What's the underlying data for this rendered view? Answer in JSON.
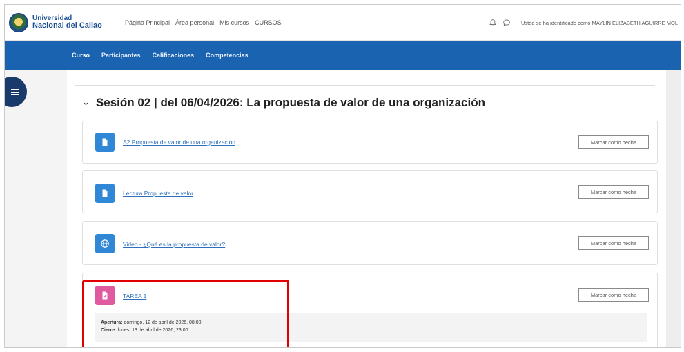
{
  "brand": {
    "line1": "Universidad",
    "line2": "Nacional del Callao"
  },
  "topnav": [
    "Página Principal",
    "Área personal",
    "Mis cursos",
    "CURSOS"
  ],
  "user_text": "Usted se ha identificado como MAYLIN ELIZABETH AGUIRRE MOL",
  "subnav": {
    "active": "Curso",
    "items": [
      "Curso",
      "Participantes",
      "Calificaciones",
      "Competencias"
    ]
  },
  "section": {
    "chevron": "⌄",
    "title": "Sesión 02 | del 06/04/2026: La propuesta de valor de una organización"
  },
  "activities": [
    {
      "icon": "file-icon",
      "name": "S2 Propuesta de valor de una organización",
      "button": "Marcar como hecha"
    },
    {
      "icon": "file-icon",
      "name": "Lectura Propuesta de valor",
      "button": "Marcar como hecha"
    },
    {
      "icon": "globe-icon",
      "name": "Video - ¿Qué es la propuesta de valor?",
      "button": "Marcar como hecha"
    },
    {
      "icon": "assignment-icon",
      "name": "TAREA 1",
      "button": "Marcar como hecha",
      "dates": {
        "open_label": "Apertura:",
        "open_value": "domingo, 12 de abril de 2026, 08:00",
        "close_label": "Cierre:",
        "close_value": "lunes, 13 de abril de 2026, 23:00"
      }
    }
  ],
  "colors": {
    "nav_blue": "#1a63b0",
    "activity_blue": "#2f87d6",
    "assignment_pink": "#e05aa0",
    "highlight_red": "#e00000"
  }
}
